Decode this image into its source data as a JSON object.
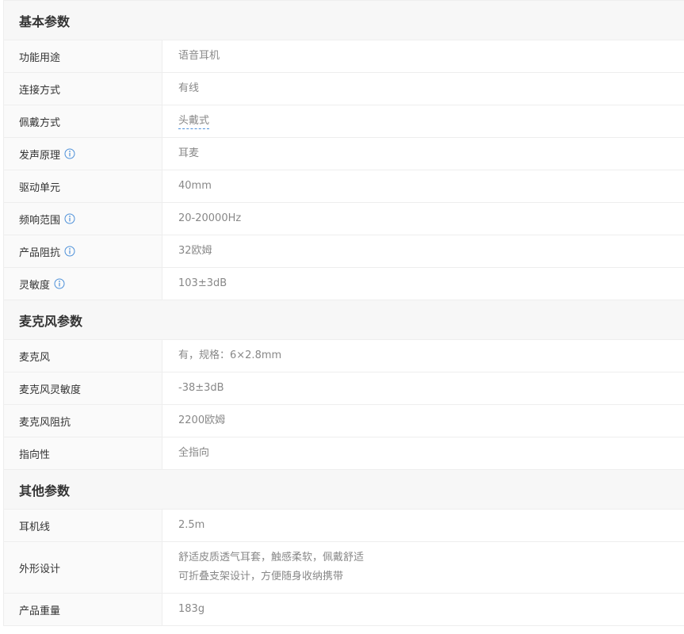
{
  "sections": [
    {
      "title": "基本参数",
      "rows": [
        {
          "label": "功能用途",
          "value": "语音耳机"
        },
        {
          "label": "连接方式",
          "value": "有线"
        },
        {
          "label": "佩戴方式",
          "value": "头戴式"
        },
        {
          "label": "发声原理",
          "value": "耳麦"
        },
        {
          "label": "驱动单元",
          "value": "40mm"
        },
        {
          "label": "频响范围",
          "value": "20-20000Hz"
        },
        {
          "label": "产品阻抗",
          "value": "32欧姆"
        },
        {
          "label": "灵敏度",
          "value": "103±3dB"
        }
      ]
    },
    {
      "title": "麦克风参数",
      "rows": [
        {
          "label": "麦克风",
          "value": "有，规格：6×2.8mm"
        },
        {
          "label": "麦克风灵敏度",
          "value": "-38±3dB"
        },
        {
          "label": "麦克风阻抗",
          "value": "2200欧姆"
        },
        {
          "label": "指向性",
          "value": "全指向"
        }
      ]
    },
    {
      "title": "其他参数",
      "rows": [
        {
          "label": "耳机线",
          "value": "2.5m"
        },
        {
          "label": "外形设计",
          "value_line1": "舒适皮质透气耳套，触感柔软，佩戴舒适",
          "value_line2": "可折叠支架设计，方便随身收纳携带"
        },
        {
          "label": "产品重量",
          "value": "183g"
        }
      ]
    }
  ],
  "colors": {
    "info_icon": "#4d90d9",
    "header_bg": "#f7f7f7",
    "label_bg": "#fafafa",
    "border": "#eeeeee",
    "value_text": "#888888"
  },
  "icons": {
    "info": "info-circle-icon"
  }
}
